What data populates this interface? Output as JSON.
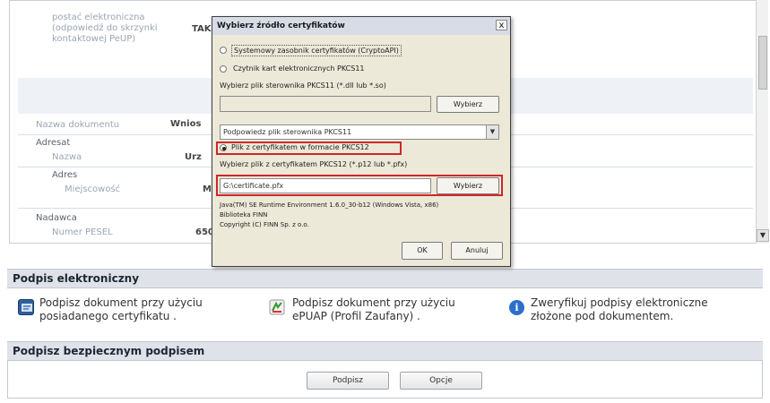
{
  "doc": {
    "row1_label_lines": [
      "postać elektroniczna",
      "(odpowiedź do skrzynki",
      "kontaktowej PeUP)"
    ],
    "row1_value": "TAK",
    "doc_name_label": "Nazwa dokumentu",
    "doc_name_value": "Wnios",
    "addressee_label": "Adresat",
    "name_label": "Nazwa",
    "name_value": "Urz",
    "address_label": "Adres",
    "city_label": "Miejscowość",
    "city_value": "M",
    "sender_label": "Nadawca",
    "pesel_label": "Numer PESEL",
    "pesel_value": "650"
  },
  "esign": {
    "title": "Podpis elektroniczny",
    "actions": [
      {
        "line1": "Podpisz dokument przy użyciu",
        "line2": "posiadanego certyfikatu .",
        "icon": "certificate-icon"
      },
      {
        "line1": "Podpisz dokument przy użyciu",
        "line2": "ePUAP (Profil Zaufany) .",
        "icon": "epuap-icon"
      },
      {
        "line1": "Zweryfikuj podpisy elektroniczne",
        "line2": "złożone pod dokumentem.",
        "icon": "info-icon"
      }
    ]
  },
  "secure": {
    "title": "Podpisz bezpiecznym podpisem",
    "sign_button": "Podpisz",
    "options_button": "Opcje"
  },
  "dialog": {
    "title": "Wybierz źródło certyfikatów",
    "close": "x",
    "radio1": "Systemowy zasobnik certyfikatów (CryptoAPI)",
    "radio2": "Czytnik kart elektronicznych PKCS11",
    "pkcs11_label": "Wybierz plik sterownika PKCS11 (*.dll lub *.so)",
    "pkcs11_path": "",
    "choose": "Wybierz",
    "hint_select": "Podpowiedz plik sterownika PKCS11",
    "radio3": "Plik z certyfikatem w formacie PKCS12",
    "pkcs12_label": "Wybierz plik z certyfikatem PKCS12 (*.p12 lub *.pfx)",
    "pkcs12_path": "G:\\certificate.pfx",
    "choose2": "Wybierz",
    "java_info": "Java(TM) SE Runtime Environment 1.6.0_30-b12 (Windows Vista, x86)",
    "lib_info": "Biblioteka FINN",
    "copyright": "Copyright (C) FINN Sp. z o.o.",
    "ok": "OK",
    "cancel": "Anuluj"
  },
  "colors": {
    "accent_red": "#d0262b",
    "section_bg": "#dfe3e9"
  }
}
